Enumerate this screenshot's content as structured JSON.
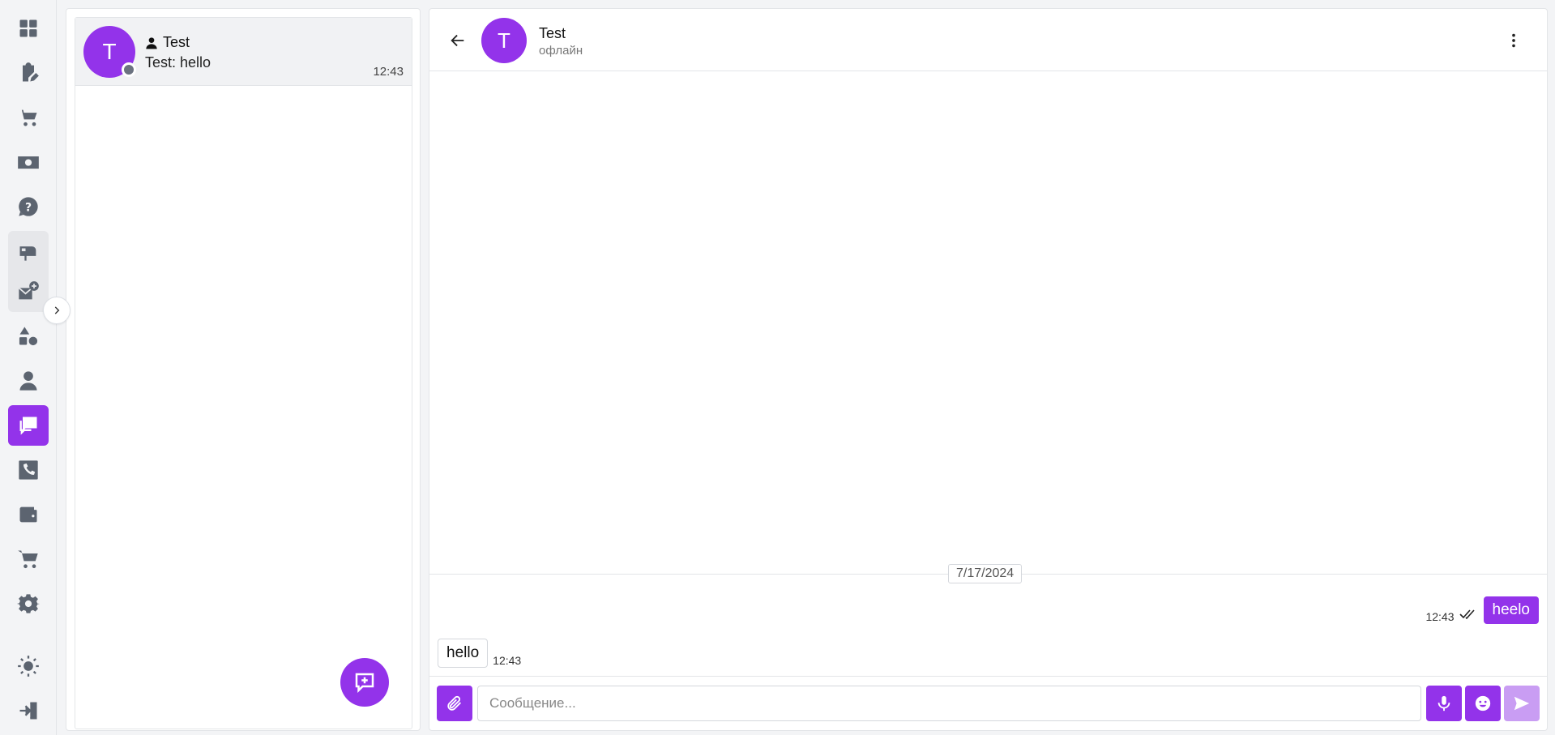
{
  "colors": {
    "accent": "#9333ea",
    "accent_light": "#c99df3",
    "offline": "#6b7280"
  },
  "rail": {
    "items": [
      "dashboard-icon",
      "tasks-icon",
      "cart-icon",
      "money-icon",
      "help-icon",
      "mailbox-icon",
      "mail-add-icon",
      "shapes-icon",
      "manager-icon",
      "chat-icon",
      "phone-icon",
      "wallet-icon",
      "shop-cart-icon",
      "settings-icon",
      "theme-icon",
      "logout-icon"
    ],
    "active": "chat-icon"
  },
  "chat_list": {
    "items": [
      {
        "avatar_letter": "T",
        "name": "Test",
        "preview": "Test: hello",
        "time": "12:43",
        "status": "offline"
      }
    ]
  },
  "conversation": {
    "avatar_letter": "T",
    "name": "Test",
    "status": "офлайн",
    "date_separator": "7/17/2024",
    "messages": [
      {
        "direction": "out",
        "text": "heelo",
        "time": "12:43",
        "read": true
      },
      {
        "direction": "in",
        "text": "hello",
        "time": "12:43"
      }
    ],
    "composer": {
      "placeholder": "Сообщение...",
      "value": ""
    }
  }
}
